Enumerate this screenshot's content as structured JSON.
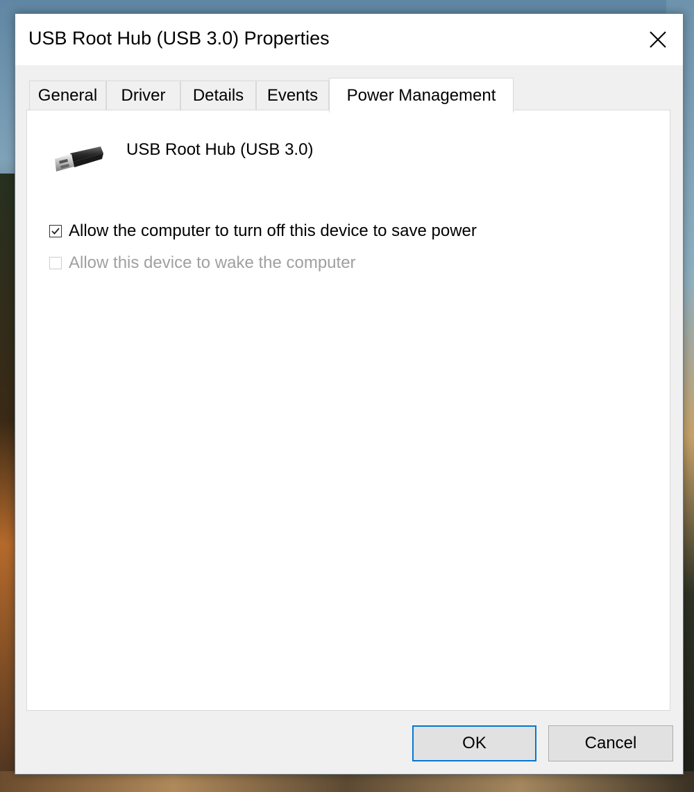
{
  "window": {
    "title": "USB Root Hub (USB 3.0) Properties",
    "close_icon": "close-icon"
  },
  "tabs": [
    {
      "label": "General",
      "active": false
    },
    {
      "label": "Driver",
      "active": false
    },
    {
      "label": "Details",
      "active": false
    },
    {
      "label": "Events",
      "active": false
    },
    {
      "label": "Power Management",
      "active": true
    }
  ],
  "device": {
    "name": "USB Root Hub (USB 3.0)",
    "icon": "usb-plug-icon"
  },
  "options": [
    {
      "label": "Allow the computer to turn off this device to save power",
      "checked": true,
      "enabled": true
    },
    {
      "label": "Allow this device to wake the computer",
      "checked": false,
      "enabled": false
    }
  ],
  "buttons": {
    "ok_label": "OK",
    "cancel_label": "Cancel"
  },
  "colors": {
    "accent": "#0078d7",
    "disabled_text": "#a0a0a0"
  }
}
